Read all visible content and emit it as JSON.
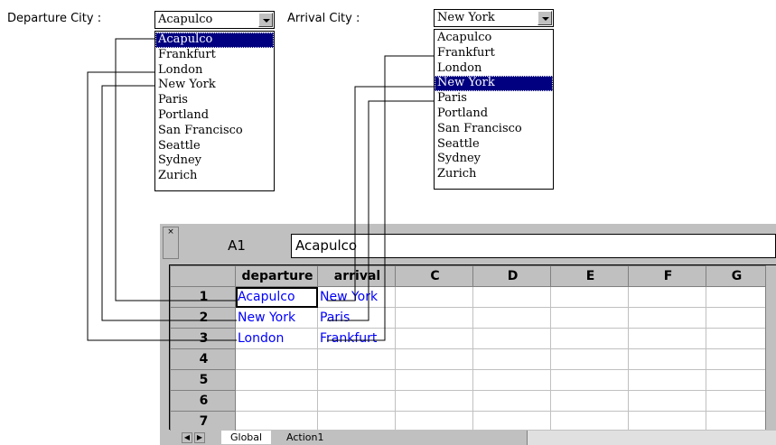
{
  "departure": {
    "label": "Departure City :",
    "selected": "Acapulco",
    "options": [
      "Acapulco",
      "Frankfurt",
      "London",
      "New York",
      "Paris",
      "Portland",
      "San Francisco",
      "Seattle",
      "Sydney",
      "Zurich"
    ]
  },
  "arrival": {
    "label": "Arrival City :",
    "selected": "New York",
    "options": [
      "Acapulco",
      "Frankfurt",
      "London",
      "New York",
      "Paris",
      "Portland",
      "San Francisco",
      "Seattle",
      "Sydney",
      "Zurich"
    ]
  },
  "sheet": {
    "name_box": "A1",
    "formula_value": "Acapulco",
    "columns": [
      "departure",
      "arrival",
      "C",
      "D",
      "E",
      "F",
      "G"
    ],
    "rows": [
      {
        "num": "1",
        "cells": [
          "Acapulco",
          "New York",
          "",
          "",
          "",
          "",
          ""
        ]
      },
      {
        "num": "2",
        "cells": [
          "New York",
          "Paris",
          "",
          "",
          "",
          "",
          ""
        ]
      },
      {
        "num": "3",
        "cells": [
          "London",
          "Frankfurt",
          "",
          "",
          "",
          "",
          ""
        ]
      },
      {
        "num": "4",
        "cells": [
          "",
          "",
          "",
          "",
          "",
          "",
          ""
        ]
      },
      {
        "num": "5",
        "cells": [
          "",
          "",
          "",
          "",
          "",
          "",
          ""
        ]
      },
      {
        "num": "6",
        "cells": [
          "",
          "",
          "",
          "",
          "",
          "",
          ""
        ]
      },
      {
        "num": "7",
        "cells": [
          "",
          "",
          "",
          "",
          "",
          "",
          ""
        ]
      }
    ],
    "tabs": [
      "Global",
      "Action1"
    ],
    "active_tab": "Global"
  }
}
